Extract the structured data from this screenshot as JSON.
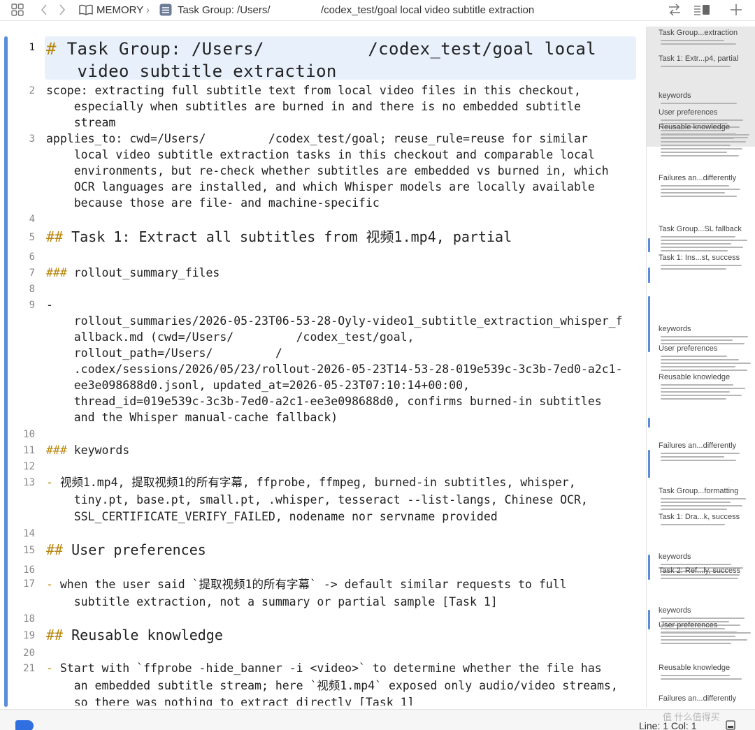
{
  "toolbar": {
    "grid_icon": "grid-icon",
    "back_icon": "chevron-left-icon",
    "forward_icon": "chevron-right-icon",
    "book_icon": "book-icon",
    "breadcrumb_root": "MEMORY",
    "breadcrumb_file": "Task Group: /Users/",
    "breadcrumb_file_tail": "/codex_test/goal local video subtitle extraction",
    "swap_icon": "swap-icon",
    "outline_icon": "sidebar-toggle-icon",
    "add_icon": "plus-icon"
  },
  "editor": {
    "lines": [
      {
        "n": "1",
        "text": "# Task Group: /Users/          /codex_test/goal local\n   video subtitle extraction"
      },
      {
        "n": "2",
        "text": "scope: extracting full subtitle text from local video files in this checkout,\n    especially when subtitles are burned in and there is no embedded subtitle\n    stream"
      },
      {
        "n": "3",
        "text": "applies_to: cwd=/Users/         /codex_test/goal; reuse_rule=reuse for similar\n    local video subtitle extraction tasks in this checkout and comparable local\n    environments, but re-check whether subtitles are embedded vs burned in, which\n    OCR languages are installed, and which Whisper models are locally available\n    because those are file- and machine-specific"
      },
      {
        "n": "4",
        "text": ""
      },
      {
        "n": "5",
        "text": "## Task 1: Extract all subtitles from 视频1.mp4, partial"
      },
      {
        "n": "6",
        "text": ""
      },
      {
        "n": "7",
        "text": "### rollout_summary_files"
      },
      {
        "n": "8",
        "text": ""
      },
      {
        "n": "9",
        "text": "-\n    rollout_summaries/2026-05-23T06-53-28-Oyly-video1_subtitle_extraction_whisper_f\n    allback.md (cwd=/Users/         /codex_test/goal,\n    rollout_path=/Users/         /\n    .codex/sessions/2026/05/23/rollout-2026-05-23T14-53-28-019e539c-3c3b-7ed0-a2c1-\n    ee3e098688d0.jsonl, updated_at=2026-05-23T07:10:14+00:00,\n    thread_id=019e539c-3c3b-7ed0-a2c1-ee3e098688d0, confirms burned-in subtitles\n    and the Whisper manual-cache fallback)"
      },
      {
        "n": "10",
        "text": ""
      },
      {
        "n": "11",
        "text": "### keywords"
      },
      {
        "n": "12",
        "text": ""
      },
      {
        "n": "13",
        "text": "- 视频1.mp4, 提取视频1的所有字幕, ffprobe, ffmpeg, burned-in subtitles, whisper,\n    tiny.pt, base.pt, small.pt, .whisper, tesseract --list-langs, Chinese OCR,\n    SSL_CERTIFICATE_VERIFY_FAILED, nodename nor servname provided"
      },
      {
        "n": "14",
        "text": ""
      },
      {
        "n": "15",
        "text": "## User preferences"
      },
      {
        "n": "16",
        "text": ""
      },
      {
        "n": "17",
        "text": "- when the user said `提取视频1的所有字幕` -> default similar requests to full\n    subtitle extraction, not a summary or partial sample [Task 1]"
      },
      {
        "n": "18",
        "text": ""
      },
      {
        "n": "19",
        "text": "## Reusable knowledge"
      },
      {
        "n": "20",
        "text": ""
      },
      {
        "n": "21",
        "text": "- Start with `ffprobe -hide_banner -i <video>` to determine whether the file has\n    an embedded subtitle stream; here `视频1.mp4` exposed only audio/video streams,\n    so there was nothing to extract directly [Task 1]"
      }
    ]
  },
  "minimap": {
    "labels": [
      "Task Group...extraction",
      "Task 1: Extr...p4, partial",
      "keywords",
      "User preferences",
      "Reusable knowledge",
      "Failures an...differently",
      "Task Group...SL fallback",
      "Task 1: Ins...st, success",
      "keywords",
      "User preferences",
      "Reusable knowledge",
      "Failures an...differently",
      "Task Group...formatting",
      "Task 1: Dra...k, success",
      "keywords",
      "Task 2: Ref...ly, success",
      "keywords",
      "User preferences",
      "Reusable knowledge",
      "Failures an...differently"
    ]
  },
  "statusbar": {
    "line_col": "Line: 1  Col: 1",
    "watermark": "值 什么值得买",
    "doc_icon": "document-icon",
    "tag_icon": "tag-icon"
  },
  "colors": {
    "accent": "#5a8fd8",
    "markdown_marker": "#b8860b",
    "active_line_bg": "#e8f0fb",
    "tag_blue": "#2f6fe0"
  }
}
